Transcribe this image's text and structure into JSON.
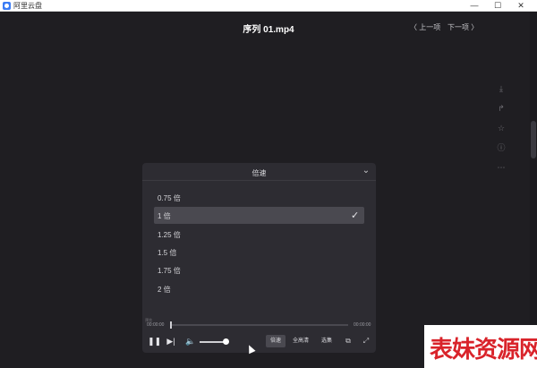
{
  "window": {
    "app_name": "阿里云盘",
    "minimize_glyph": "—",
    "maximize_glyph": "☐",
    "close_glyph": "✕"
  },
  "header": {
    "title": "序列 01.mp4",
    "prev_label": "〈 上一项",
    "next_label": "下一项 〉"
  },
  "side_actions": [
    {
      "icon": "download-icon",
      "glyph": "⤓"
    },
    {
      "icon": "share-icon",
      "glyph": "↱"
    },
    {
      "icon": "star-icon",
      "glyph": "☆"
    },
    {
      "icon": "info-icon",
      "glyph": "ⓘ"
    },
    {
      "icon": "more-icon",
      "glyph": "⋯"
    }
  ],
  "speed_panel": {
    "title": "倍速",
    "collapse_glyph": "⌄",
    "options": [
      {
        "label": "0.75 倍",
        "selected": false
      },
      {
        "label": "1 倍",
        "selected": true
      },
      {
        "label": "1.25 倍",
        "selected": false
      },
      {
        "label": "1.5 倍",
        "selected": false
      },
      {
        "label": "1.75 倍",
        "selected": false
      },
      {
        "label": "2 倍",
        "selected": false
      }
    ],
    "check_glyph": "✓"
  },
  "player": {
    "tooltip": "预览",
    "time_current": "00:00:00",
    "time_total": "00:00:00",
    "progress": 0,
    "volume": 0.9,
    "pause_glyph": "❚❚",
    "next_glyph": "▶|",
    "volume_glyph": "🔈",
    "speed_label": "倍速",
    "quality_label": "全高清",
    "episodes_label": "选集",
    "pip_glyph": "⧉",
    "fullscreen_glyph": "⤢"
  },
  "watermark": {
    "text": "表妹资源网"
  },
  "colors": {
    "background": "#1f1e22",
    "panel": "#2d2c32",
    "selected": "#4a4950",
    "watermark_red": "#d9232a"
  }
}
